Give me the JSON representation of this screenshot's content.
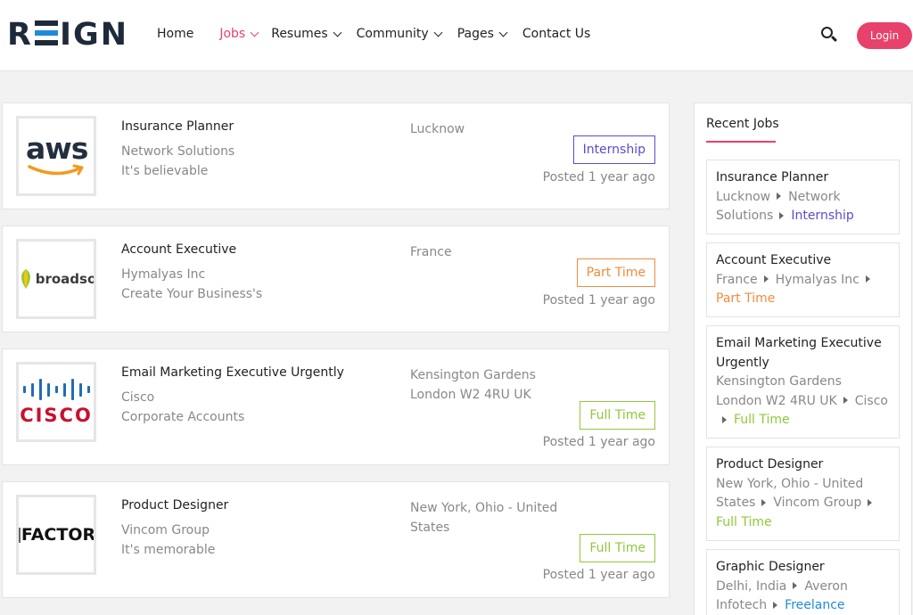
{
  "header": {
    "logo_text": "REIGN",
    "nav": [
      {
        "label": "Home"
      },
      {
        "label": "Jobs"
      },
      {
        "label": "Resumes"
      },
      {
        "label": "Community"
      },
      {
        "label": "Pages"
      },
      {
        "label": "Contact Us"
      }
    ],
    "login_label": "Login"
  },
  "colors": {
    "accent": "#e8416b",
    "internship": "#5a4ccf",
    "part_time": "#f08c3c",
    "full_time": "#8fc93a",
    "freelance": "#1f8bd8"
  },
  "jobs": [
    {
      "title": "Insurance Planner",
      "company": "Network Solutions",
      "tagline": "It's believable",
      "location": "Lucknow",
      "type": "Internship",
      "posted": "Posted 1 year ago",
      "logo_text": "aws"
    },
    {
      "title": "Account Executive",
      "company": "Hymalyas Inc",
      "tagline": "Create Your Business's",
      "location": "France",
      "type": "Part Time",
      "posted": "Posted 1 year ago",
      "logo_text": "broadso"
    },
    {
      "title": "Email Marketing Executive Urgently",
      "company": "Cisco",
      "tagline": "Corporate Accounts",
      "location": "Kensington Gardens London W2 4RU UK",
      "type": "Full Time",
      "posted": "Posted 1 year ago",
      "logo_text": "CISCO"
    },
    {
      "title": "Product Designer",
      "company": "Vincom Group",
      "tagline": "It's memorable",
      "location": "New York, Ohio - United States",
      "type": "Full Time",
      "posted": "Posted 1 year ago",
      "logo_text": "FACTOR"
    }
  ],
  "sidebar": {
    "title": "Recent Jobs",
    "items": [
      {
        "title": "Insurance Planner",
        "location": "Lucknow",
        "company": "Network Solutions",
        "type": "Internship"
      },
      {
        "title": "Account Executive",
        "location": "France",
        "company": "Hymalyas Inc",
        "type": "Part Time"
      },
      {
        "title": "Email Marketing Executive Urgently",
        "location": "Kensington Gardens London W2 4RU UK",
        "company": "Cisco",
        "type": "Full Time"
      },
      {
        "title": "Product Designer",
        "location": "New York, Ohio - United States",
        "company": "Vincom Group",
        "type": "Full Time"
      },
      {
        "title": "Graphic Designer",
        "location": "Delhi, India",
        "company": "Averon Infotech",
        "type": "Freelance"
      }
    ]
  }
}
